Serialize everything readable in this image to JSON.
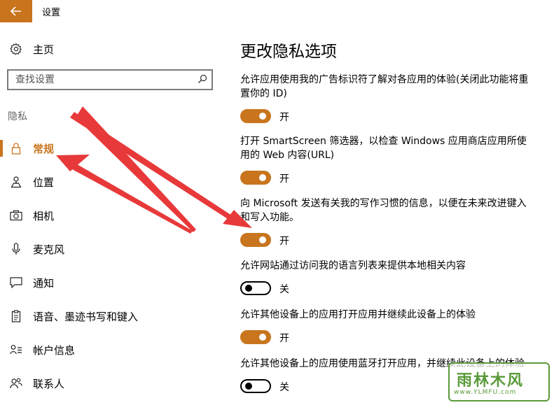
{
  "window": {
    "title": "设置"
  },
  "sidebar": {
    "home_label": "主页",
    "search_placeholder": "查找设置",
    "section_heading": "隐私",
    "items": [
      {
        "label": "常规",
        "icon": "lock-icon",
        "active": true
      },
      {
        "label": "位置",
        "icon": "location-icon",
        "active": false
      },
      {
        "label": "相机",
        "icon": "camera-icon",
        "active": false
      },
      {
        "label": "麦克风",
        "icon": "microphone-icon",
        "active": false
      },
      {
        "label": "通知",
        "icon": "chat-bubble-icon",
        "active": false
      },
      {
        "label": "语音、墨迹书写和键入",
        "icon": "clipboard-icon",
        "active": false
      },
      {
        "label": "帐户信息",
        "icon": "account-info-icon",
        "active": false
      },
      {
        "label": "联系人",
        "icon": "contacts-icon",
        "active": false
      }
    ]
  },
  "main": {
    "title": "更改隐私选项",
    "settings": [
      {
        "desc_line1": "允许应用使用我的广告标识符了解对各应用的体验(关闭此功能将重",
        "desc_line2": "置你的 ID)",
        "state": "开",
        "on": true
      },
      {
        "desc_line1": "打开 SmartScreen 筛选器，以检查 Windows 应用商店应用所使",
        "desc_line2": "用的 Web 内容(URL)",
        "state": "开",
        "on": true
      },
      {
        "desc_line1": "向 Microsoft 发送有关我的写作习惯的信息，以便在未来改进键入",
        "desc_line2": "和写入功能。",
        "state": "开",
        "on": true
      },
      {
        "desc_line1": "允许网站通过访问我的语言列表来提供本地相关内容",
        "desc_line2": "",
        "state": "关",
        "on": false
      },
      {
        "desc_line1": "允许其他设备上的应用打开应用并继续此设备上的体验",
        "desc_line2": "",
        "state": "开",
        "on": true
      },
      {
        "desc_line1": "允许其他设备上的应用使用蓝牙打开应用，并继续此设备上的体验",
        "desc_line2": "",
        "state": "关",
        "on": false
      }
    ]
  },
  "watermark": {
    "main": "雨林木风",
    "sub": "www.YLMFU.com"
  },
  "colors": {
    "accent": "#c8751e",
    "arrow": "#e8393a"
  }
}
